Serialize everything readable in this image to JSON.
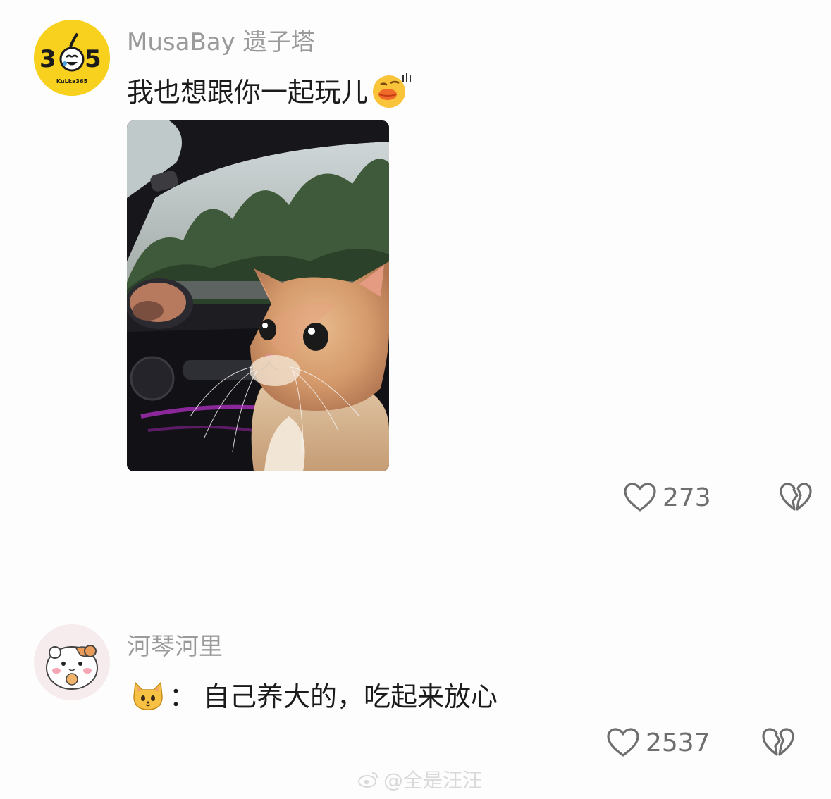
{
  "comments": [
    {
      "avatar": {
        "brand_text": "365",
        "sub_text": "KuLka365",
        "bg": "#f7d11e"
      },
      "username": "MusaBay 遗子塔",
      "text": "我也想跟你一起玩儿",
      "likes": "273"
    },
    {
      "username": "河琴河里",
      "prefix": "：",
      "text": "自己养大的，吃起来放心",
      "likes": "2537"
    }
  ],
  "watermark": "@全是汪汪",
  "colors": {
    "username": "#9a9a9a",
    "text": "#1b1b1b",
    "icon": "#6e6e6e",
    "brand_yellow": "#f7d11e"
  }
}
